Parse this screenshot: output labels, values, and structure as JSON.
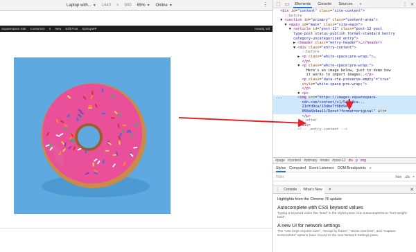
{
  "device_toolbar": {
    "device": "Laptop with...",
    "width": "1440",
    "separator": "×",
    "height": "900",
    "zoom": "65%",
    "throttle": "Online"
  },
  "admin_bar": {
    "items": [
      "Squarespace Site",
      "Customize",
      "0",
      "New",
      "Edit Post",
      "SpinupWP"
    ],
    "right": "Howdy, vid"
  },
  "devtools": {
    "tabs": [
      "Elements",
      "Console",
      "Sources"
    ],
    "more": "»",
    "tree": [
      {
        "indent": "  ",
        "parts": [
          [
            "tag",
            "<div "
          ],
          [
            "attr",
            "id"
          ],
          [
            "txt",
            "="
          ],
          [
            "val",
            "\"content\""
          ],
          [
            "txt",
            " "
          ],
          [
            "attr",
            "class"
          ],
          [
            "txt",
            "="
          ],
          [
            "val",
            "\"site-content\""
          ],
          [
            "tag",
            ">"
          ]
        ]
      },
      {
        "indent": "    ",
        "parts": [
          [
            "pseudo",
            "::before"
          ]
        ]
      },
      {
        "indent": "  ▼ ",
        "parts": [
          [
            "tag",
            "<section "
          ],
          [
            "attr",
            "id"
          ],
          [
            "txt",
            "="
          ],
          [
            "val",
            "\"primary\""
          ],
          [
            "txt",
            " "
          ],
          [
            "attr",
            "class"
          ],
          [
            "txt",
            "="
          ],
          [
            "val",
            "\"content-area\""
          ],
          [
            "tag",
            ">"
          ]
        ]
      },
      {
        "indent": "    ▼ ",
        "parts": [
          [
            "tag",
            "<main "
          ],
          [
            "attr",
            "id"
          ],
          [
            "txt",
            "="
          ],
          [
            "val",
            "\"main\""
          ],
          [
            "txt",
            " "
          ],
          [
            "attr",
            "class"
          ],
          [
            "txt",
            "="
          ],
          [
            "val",
            "\"site-main\""
          ],
          [
            "tag",
            ">"
          ]
        ]
      },
      {
        "indent": "      ▼ ",
        "parts": [
          [
            "tag",
            "<article "
          ],
          [
            "attr",
            "id"
          ],
          [
            "txt",
            "="
          ],
          [
            "val",
            "\"post-12\""
          ],
          [
            "txt",
            " "
          ],
          [
            "attr",
            "class"
          ],
          [
            "txt",
            "="
          ],
          [
            "val",
            "\"post-12 post"
          ]
        ]
      },
      {
        "indent": "        ",
        "parts": [
          [
            "val",
            "type-post status-publish format-standard hentry"
          ]
        ]
      },
      {
        "indent": "        ",
        "parts": [
          [
            "val",
            "category-uncategorized entry\""
          ],
          [
            "tag",
            ">"
          ]
        ]
      },
      {
        "indent": "        ▶ ",
        "parts": [
          [
            "tag",
            "<header "
          ],
          [
            "attr",
            "class"
          ],
          [
            "txt",
            "="
          ],
          [
            "val",
            "\"entry-header\""
          ],
          [
            "tag",
            ">"
          ],
          [
            "txt",
            "…"
          ],
          [
            "tag",
            "</header>"
          ]
        ]
      },
      {
        "indent": "        ▼ ",
        "parts": [
          [
            "tag",
            "<div "
          ],
          [
            "attr",
            "class"
          ],
          [
            "txt",
            "="
          ],
          [
            "val",
            "\"entry-content\""
          ],
          [
            "tag",
            ">"
          ]
        ]
      },
      {
        "indent": "            ",
        "parts": [
          [
            "pseudo",
            "::before"
          ]
        ]
      },
      {
        "indent": "          ▶ ",
        "parts": [
          [
            "tag",
            "<p "
          ],
          [
            "attr",
            "class"
          ],
          [
            "txt",
            "="
          ],
          [
            "val",
            "\"white-space:pre-wrap;\""
          ],
          [
            "tag",
            ">"
          ],
          [
            "txt",
            "…"
          ]
        ]
      },
      {
        "indent": "            ",
        "parts": [
          [
            "tag",
            "</p>"
          ]
        ]
      },
      {
        "indent": "          ▼ ",
        "parts": [
          [
            "tag",
            "<p "
          ],
          [
            "attr",
            "class"
          ],
          [
            "txt",
            "="
          ],
          [
            "val",
            "\"white-space:pre-wrap;\""
          ],
          [
            "tag",
            ">"
          ]
        ]
      },
      {
        "indent": "              ",
        "parts": [
          [
            "txt",
            "Here's an image below, just to demo how"
          ]
        ]
      },
      {
        "indent": "              ",
        "parts": [
          [
            "txt",
            "it works to import images.."
          ],
          [
            "tag",
            "</p>"
          ]
        ]
      },
      {
        "indent": "            ",
        "parts": [
          [
            "tag",
            "<p "
          ],
          [
            "attr",
            "class"
          ],
          [
            "txt",
            "="
          ],
          [
            "val",
            "\"data-rte-preserve-empty\""
          ],
          [
            "txt",
            "="
          ],
          [
            "val",
            "\"true\""
          ]
        ]
      },
      {
        "indent": "            ",
        "parts": [
          [
            "attr",
            "style"
          ],
          [
            "txt",
            "="
          ],
          [
            "val",
            "\"white-space:pre-wrap;\""
          ],
          [
            "tag",
            ">"
          ]
        ]
      },
      {
        "indent": "            ",
        "parts": [
          [
            "tag",
            "</p>"
          ]
        ]
      },
      {
        "indent": "          ▼ ",
        "parts": [
          [
            "tag",
            "<p>"
          ]
        ]
      },
      {
        "indent": "... ",
        "selected": true,
        "parts": [
          [
            "tag",
            "      <img "
          ],
          [
            "attr",
            "src"
          ],
          [
            "txt",
            "="
          ],
          [
            "val",
            "\"https://images.squarespace-"
          ]
        ]
      },
      {
        "indent": "    ",
        "selected": true,
        "parts": [
          [
            "val",
            "        cdn.com/content/v1/5d5b8ca..."
          ]
        ]
      },
      {
        "indent": "    ",
        "selected": true,
        "parts": [
          [
            "val",
            "        21dfd9ca/13dbe7f08d9ea9"
          ]
        ]
      },
      {
        "indent": "    ",
        "selected": true,
        "parts": [
          [
            "val",
            "        058a6b4aa11/Donut?format=original\""
          ],
          [
            "txt",
            " "
          ],
          [
            "attr",
            "alt"
          ],
          [
            "txt",
            "="
          ]
        ]
      },
      {
        "indent": "            ",
        "parts": [
          [
            "tag",
            "</p>"
          ]
        ]
      },
      {
        "indent": "            ",
        "parts": [
          [
            "pseudo",
            "::after"
          ]
        ]
      },
      {
        "indent": "          ",
        "parts": [
          [
            "tag",
            "</div>"
          ]
        ]
      },
      {
        "indent": "          ",
        "parts": [
          [
            "pseudo",
            "<!-- .entry-content -->"
          ]
        ]
      }
    ],
    "breadcrumbs": [
      "#page",
      "#content",
      "#primary",
      "#main",
      "#post-12",
      "div",
      "p",
      "img"
    ],
    "subtabs": [
      "Styles",
      "Computed",
      "Event Listeners",
      "DOM Breakpoints",
      "»"
    ],
    "filter_placeholder": "Filter",
    "filter_right": [
      ":hov",
      ".cls",
      "+"
    ],
    "drawer_tabs": [
      "Console",
      "What's New"
    ],
    "whats_new": {
      "header": "Highlights from the Chrome 76 update",
      "items": [
        {
          "title": "Autocomplete with CSS keyword values",
          "desc": "Typing a keyword value like \"bold\" in the Styles pane now autocompletes to \"font-weight: bold\"."
        },
        {
          "title": "A new UI for network settings",
          "desc": "The \"Use large request rows\", \"Group by frame\", \"Show overview\", and \"Capture screenshots\" options have moved to the new Network Settings pane."
        }
      ]
    }
  },
  "colors": {
    "accent": "#1a73e8",
    "annotation": "#e0232b",
    "image_bg": "#5ea9df",
    "donut_frosting": "#ea4f9a"
  }
}
